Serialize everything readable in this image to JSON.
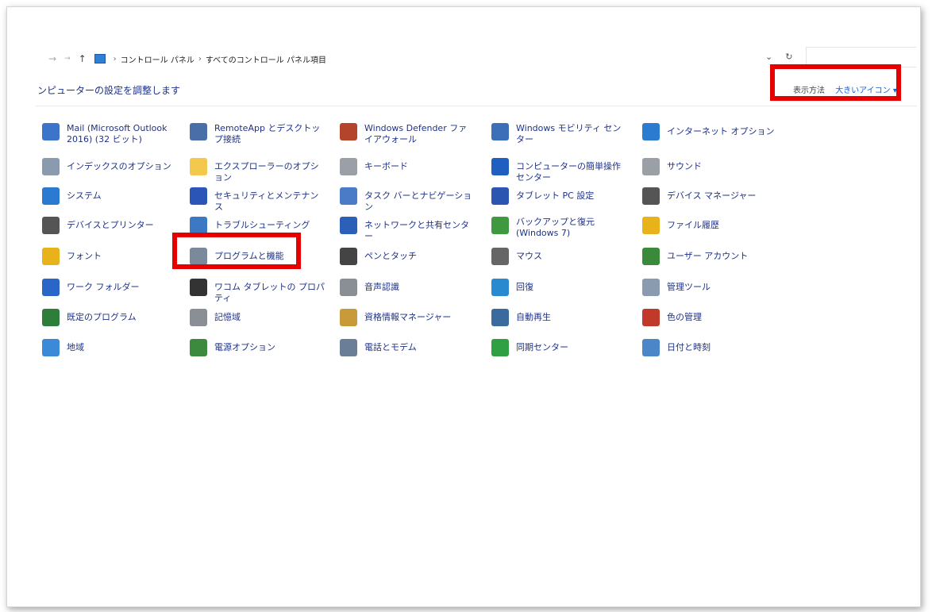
{
  "nav": {
    "back": "→",
    "forward": "→",
    "up": "↑",
    "breadcrumb": [
      "コントロール パネル",
      "すべてのコントロール パネル項目"
    ],
    "dropdown": "⌄",
    "refresh": "↻"
  },
  "header": {
    "title": "ンピューターの設定を調整します",
    "view_label": "表示方法",
    "view_value": "大きいアイコン ▾"
  },
  "items": [
    {
      "label": "Mail (Microsoft Outlook 2016) (32 ビット)",
      "icon": "mail-icon",
      "color": "#3b74c9"
    },
    {
      "label": "インデックスのオプション",
      "icon": "index-options-icon",
      "color": "#8a9bb0"
    },
    {
      "label": "システム",
      "icon": "system-icon",
      "color": "#2a7ad2"
    },
    {
      "label": "デバイスとプリンター",
      "icon": "printer-icon",
      "color": "#555555"
    },
    {
      "label": "フォント",
      "icon": "font-icon",
      "color": "#e8b31a"
    },
    {
      "label": "ワーク フォルダー",
      "icon": "work-folders-icon",
      "color": "#2a66c8"
    },
    {
      "label": "既定のプログラム",
      "icon": "default-programs-icon",
      "color": "#2f7d3a"
    },
    {
      "label": "地域",
      "icon": "region-icon",
      "color": "#3a8ad8"
    },
    {
      "label": "RemoteApp とデスクトップ接続",
      "icon": "remoteapp-icon",
      "color": "#4a6fa8"
    },
    {
      "label": "エクスプローラーのオプション",
      "icon": "explorer-options-icon",
      "color": "#f2c94c"
    },
    {
      "label": "セキュリティとメンテナンス",
      "icon": "security-flag-icon",
      "color": "#2b56b7"
    },
    {
      "label": "トラブルシューティング",
      "icon": "troubleshoot-icon",
      "color": "#3d78c4"
    },
    {
      "label": "プログラムと機能",
      "icon": "programs-features-icon",
      "color": "#7a8a9a"
    },
    {
      "label": "ワコム タブレットの プロパティ",
      "icon": "wacom-tablet-icon",
      "color": "#333333"
    },
    {
      "label": "記憶域",
      "icon": "storage-icon",
      "color": "#8a8f96"
    },
    {
      "label": "電源オプション",
      "icon": "power-options-icon",
      "color": "#3c8a3e"
    },
    {
      "label": "Windows Defender ファイアウォール",
      "icon": "firewall-icon",
      "color": "#b5442c"
    },
    {
      "label": "キーボード",
      "icon": "keyboard-icon",
      "color": "#9aa0a6"
    },
    {
      "label": "タスク バーとナビゲーション",
      "icon": "taskbar-icon",
      "color": "#4b7bc7"
    },
    {
      "label": "ネットワークと共有センター",
      "icon": "network-icon",
      "color": "#2b5fb8"
    },
    {
      "label": "ペンとタッチ",
      "icon": "pen-icon",
      "color": "#444444"
    },
    {
      "label": "音声認識",
      "icon": "microphone-icon",
      "color": "#8a8f96"
    },
    {
      "label": "資格情報マネージャー",
      "icon": "credential-icon",
      "color": "#c89a3a"
    },
    {
      "label": "電話とモデム",
      "icon": "phone-modem-icon",
      "color": "#6a7f97"
    },
    {
      "label": "Windows モビリティ センター",
      "icon": "mobility-icon",
      "color": "#3d6fb8"
    },
    {
      "label": "コンピューターの簡単操作センター",
      "icon": "ease-of-access-icon",
      "color": "#1f5fc0"
    },
    {
      "label": "タブレット PC 設定",
      "icon": "tablet-pc-icon",
      "color": "#2a55b0"
    },
    {
      "label": "バックアップと復元 (Windows 7)",
      "icon": "backup-icon",
      "color": "#3f9a3f"
    },
    {
      "label": "マウス",
      "icon": "mouse-icon",
      "color": "#666666"
    },
    {
      "label": "回復",
      "icon": "recovery-icon",
      "color": "#2a8ad0"
    },
    {
      "label": "自動再生",
      "icon": "autoplay-icon",
      "color": "#3b6a9e"
    },
    {
      "label": "同期センター",
      "icon": "sync-center-icon",
      "color": "#2fa043"
    },
    {
      "label": "インターネット オプション",
      "icon": "internet-options-icon",
      "color": "#2b7bd0"
    },
    {
      "label": "サウンド",
      "icon": "sound-icon",
      "color": "#9aa0a6"
    },
    {
      "label": "デバイス マネージャー",
      "icon": "device-manager-icon",
      "color": "#555555"
    },
    {
      "label": "ファイル履歴",
      "icon": "file-history-icon",
      "color": "#e8b31a"
    },
    {
      "label": "ユーザー アカウント",
      "icon": "user-accounts-icon",
      "color": "#3b8a3b"
    },
    {
      "label": "管理ツール",
      "icon": "admin-tools-icon",
      "color": "#8a9bb0"
    },
    {
      "label": "色の管理",
      "icon": "color-management-icon",
      "color": "#c0392b"
    },
    {
      "label": "日付と時刻",
      "icon": "date-time-icon",
      "color": "#4a86c8"
    }
  ]
}
